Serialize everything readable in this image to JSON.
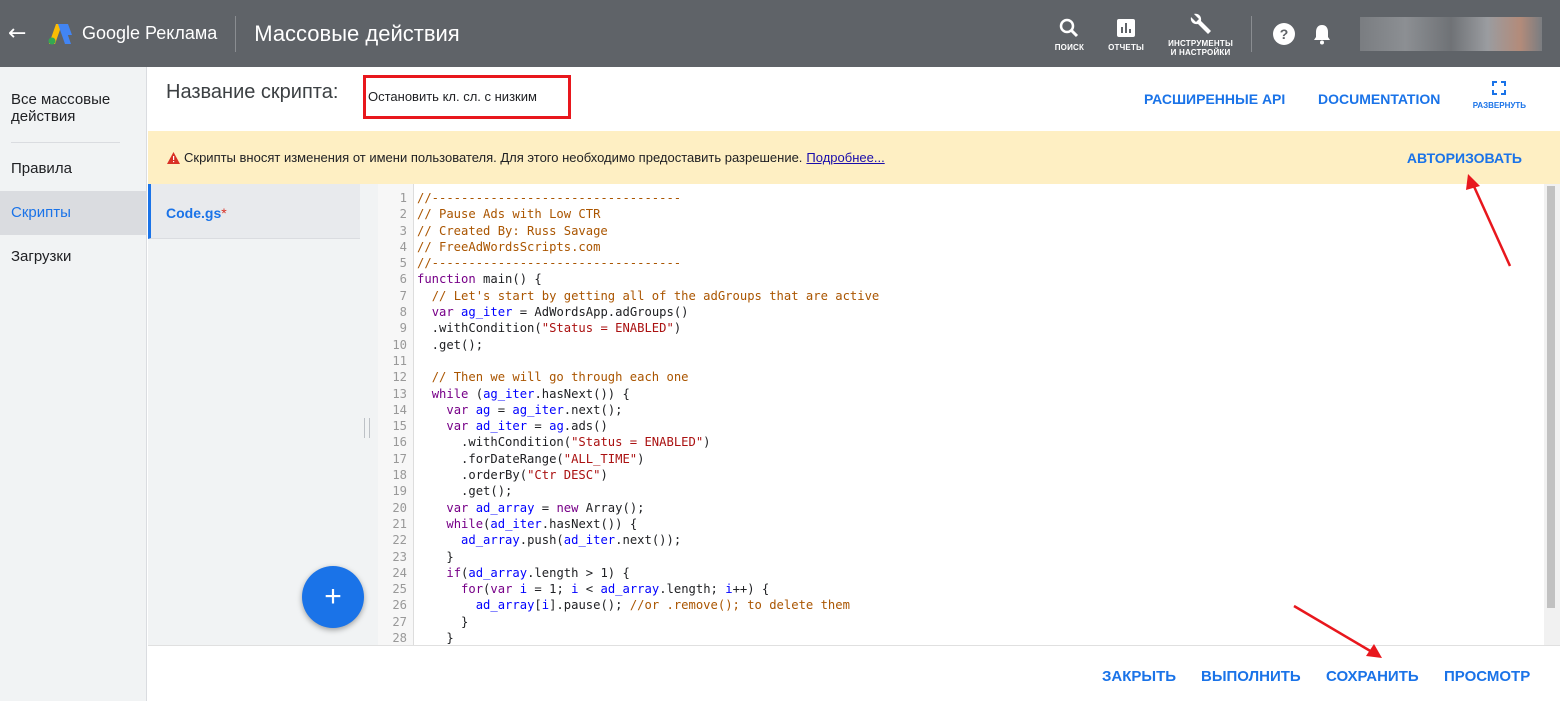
{
  "topbar": {
    "brand": "Google Реклама",
    "title": "Массовые действия",
    "tools": [
      {
        "icon": "search-icon",
        "label": "ПОИСК"
      },
      {
        "icon": "reports-icon",
        "label": "ОТЧЕТЫ"
      },
      {
        "icon": "wrench-icon",
        "label": "ИНСТРУМЕНТЫ\nИ НАСТРОЙКИ"
      }
    ]
  },
  "leftnav": {
    "all": "Все массовые действия",
    "rules": "Правила",
    "scripts": "Скрипты",
    "uploads": "Загрузки"
  },
  "header": {
    "script_label": "Название скрипта:",
    "script_name": "Остановить кл. сл. с низким",
    "advanced_api": "РАСШИРЕННЫЕ API",
    "documentation": "DOCUMENTATION",
    "expand": "РАЗВЕРНУТЬ"
  },
  "banner": {
    "text": "Скрипты вносят изменения от имени пользователя. Для этого необходимо предоставить разрешение.",
    "link": "Подробнее...",
    "authorize": "АВТОРИЗОВАТЬ"
  },
  "files": {
    "name": "Code.gs",
    "modified_mark": "*"
  },
  "fab": "+",
  "code_lines": [
    "//----------------------------------",
    "// Pause Ads with Low CTR",
    "// Created By: Russ Savage",
    "// FreeAdWordsScripts.com",
    "//----------------------------------",
    "function main() {",
    "  // Let's start by getting all of the adGroups that are active",
    "  var ag_iter = AdWordsApp.adGroups()",
    "  .withCondition(\"Status = ENABLED\")",
    "  .get();",
    "",
    "  // Then we will go through each one",
    "  while (ag_iter.hasNext()) {",
    "    var ag = ag_iter.next();",
    "    var ad_iter = ag.ads()",
    "      .withCondition(\"Status = ENABLED\")",
    "      .forDateRange(\"ALL_TIME\")",
    "      .orderBy(\"Ctr DESC\")",
    "      .get();",
    "    var ad_array = new Array();",
    "    while(ad_iter.hasNext()) {",
    "      ad_array.push(ad_iter.next());",
    "    }",
    "    if(ad_array.length > 1) {",
    "      for(var i = 1; i < ad_array.length; i++) {",
    "        ad_array[i].pause(); //or .remove(); to delete them",
    "      }",
    "    }"
  ],
  "footer": {
    "close": "ЗАКРЫТЬ",
    "run": "ВЫПОЛНИТЬ",
    "save": "СОХРАНИТЬ",
    "preview": "ПРОСМОТР"
  },
  "colors": {
    "topbar": "#5f6368",
    "accent": "#1a73e8",
    "banner": "#feefc3",
    "highlight_box": "#e8171d"
  }
}
